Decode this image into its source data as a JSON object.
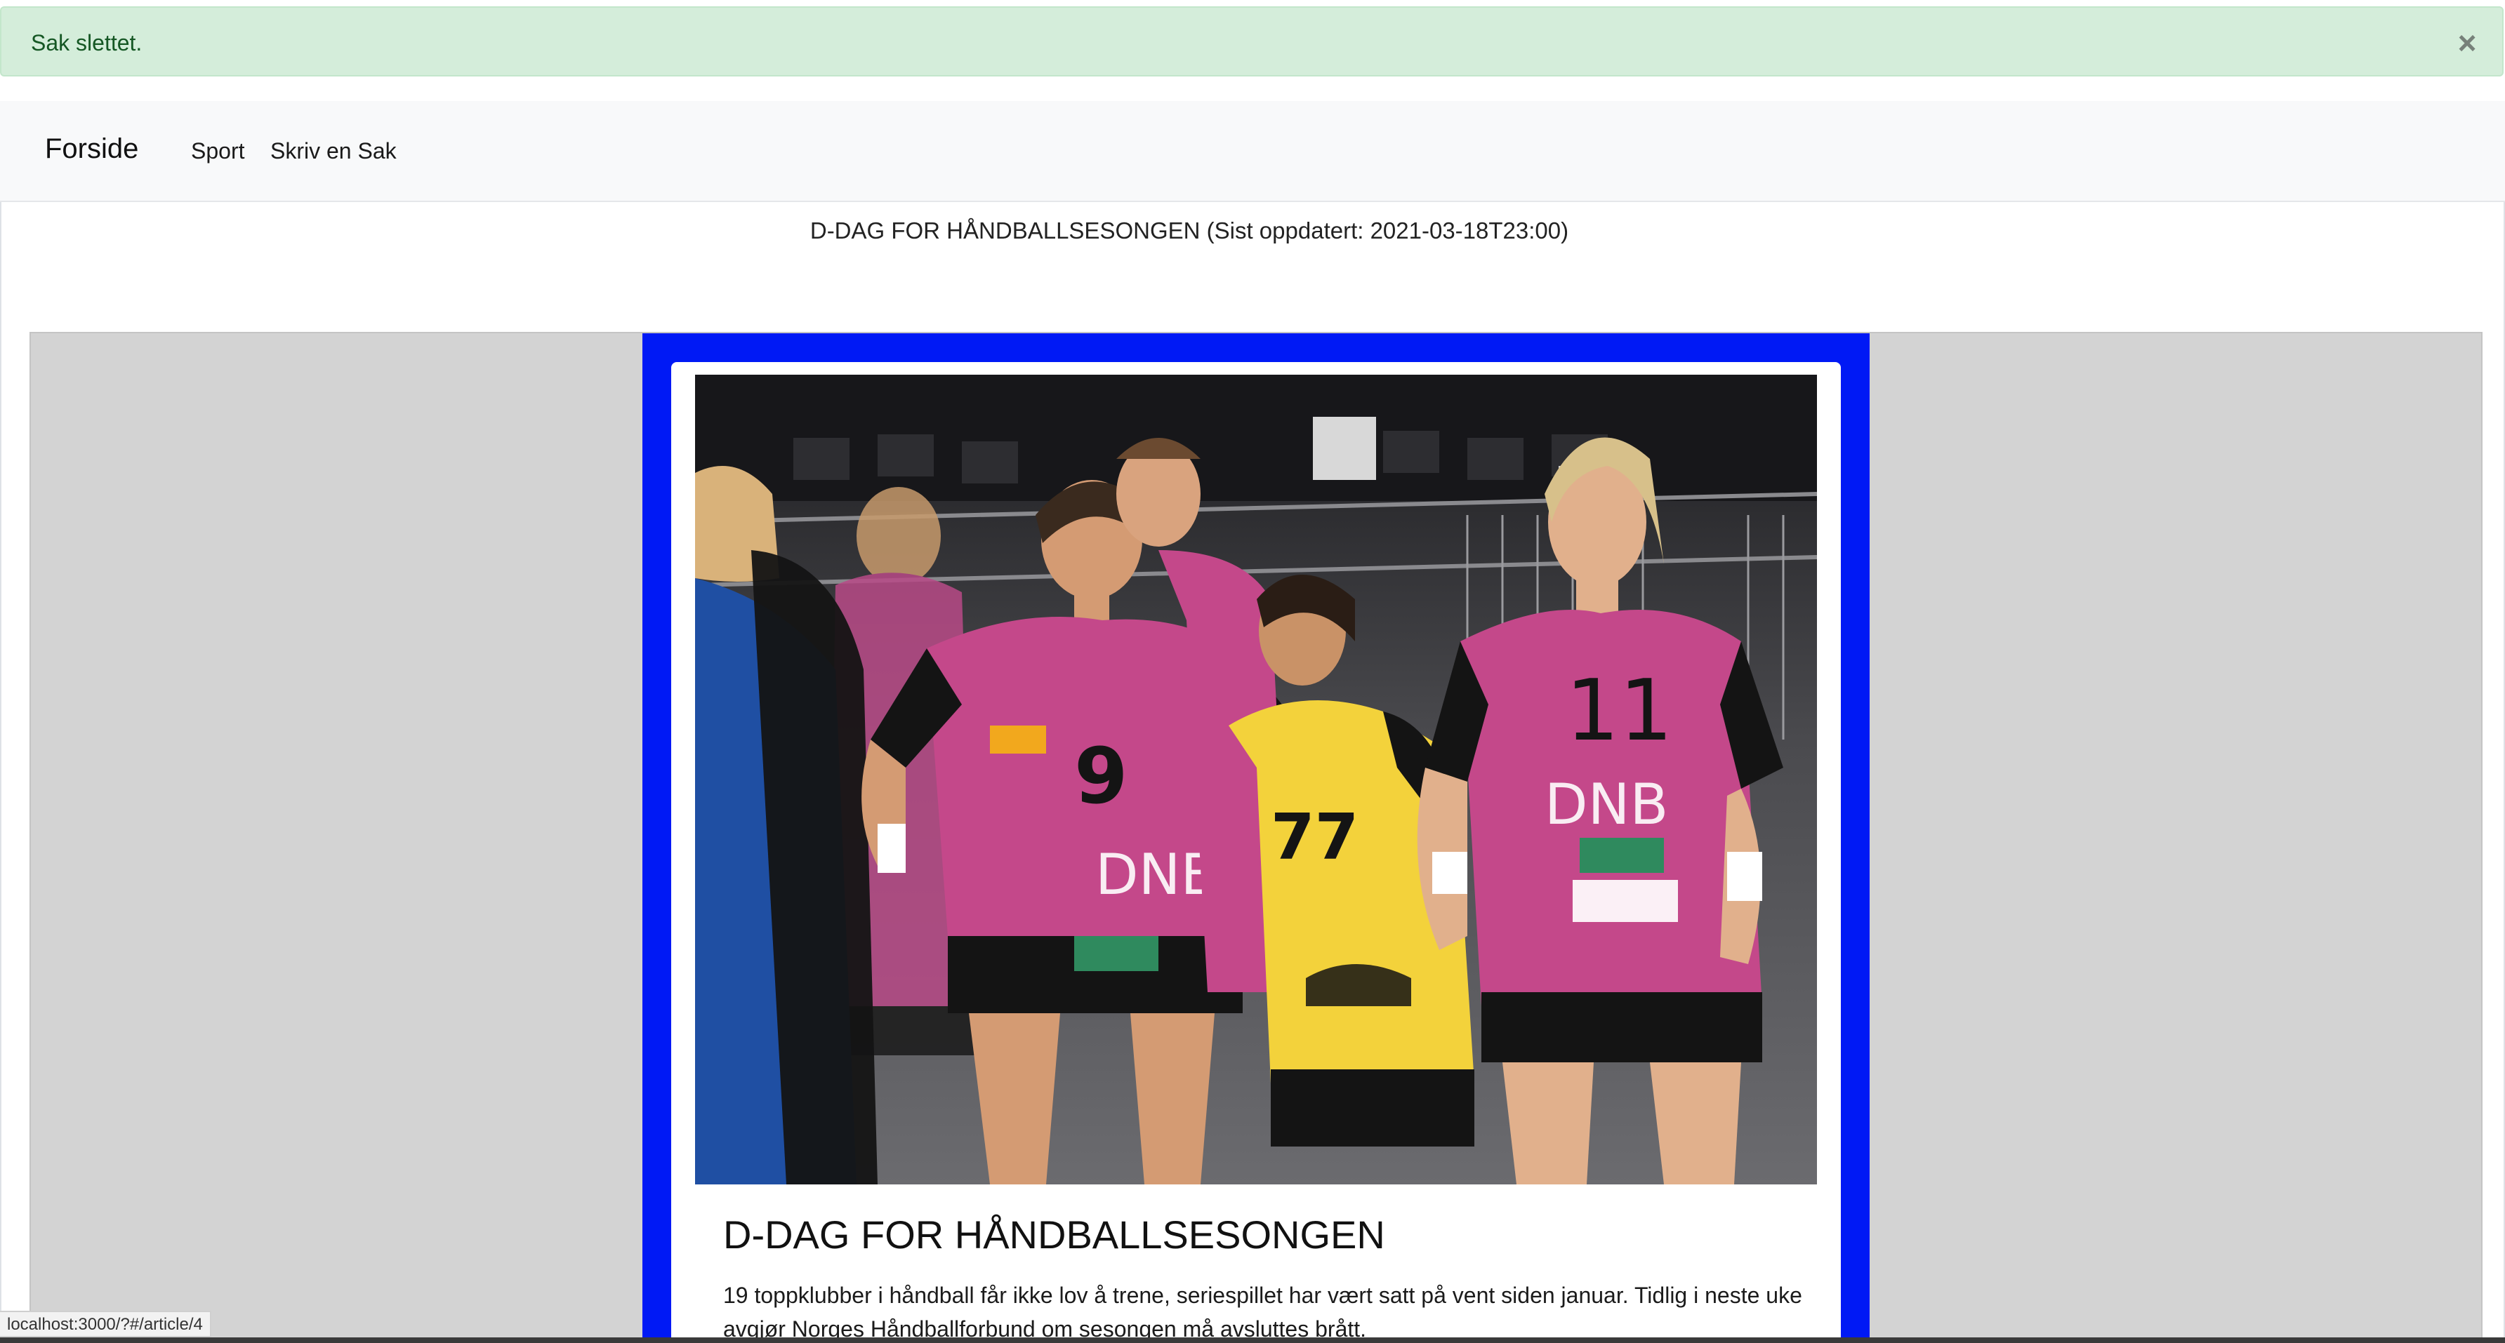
{
  "alert": {
    "text": "Sak slettet.",
    "close_label": "×"
  },
  "nav": {
    "brand": "Forside",
    "links": [
      "Sport",
      "Skriv en Sak"
    ]
  },
  "page": {
    "title": "D-DAG FOR HÅNDBALLSESONGEN (Sist oppdatert: 2021-03-18T23:00)"
  },
  "article": {
    "heading": "D-DAG FOR HÅNDBALLSESONGEN",
    "lead": "19 toppklubber i håndball får ikke lov å trene, seriespillet har vært satt på vent siden januar. Tidlig i neste uke avgjør Norges Håndballforbund om sesongen må avsluttes brått.",
    "jersey_numbers": [
      "9",
      "77",
      "11"
    ]
  },
  "status_bar": {
    "url": "localhost:3000/?#/article/4"
  },
  "colors": {
    "alert_bg": "#d4edda",
    "alert_text": "#155724",
    "card_frame": "#0019f5",
    "jersey_pink": "#c4488a",
    "jersey_yellow": "#f3d23b"
  }
}
